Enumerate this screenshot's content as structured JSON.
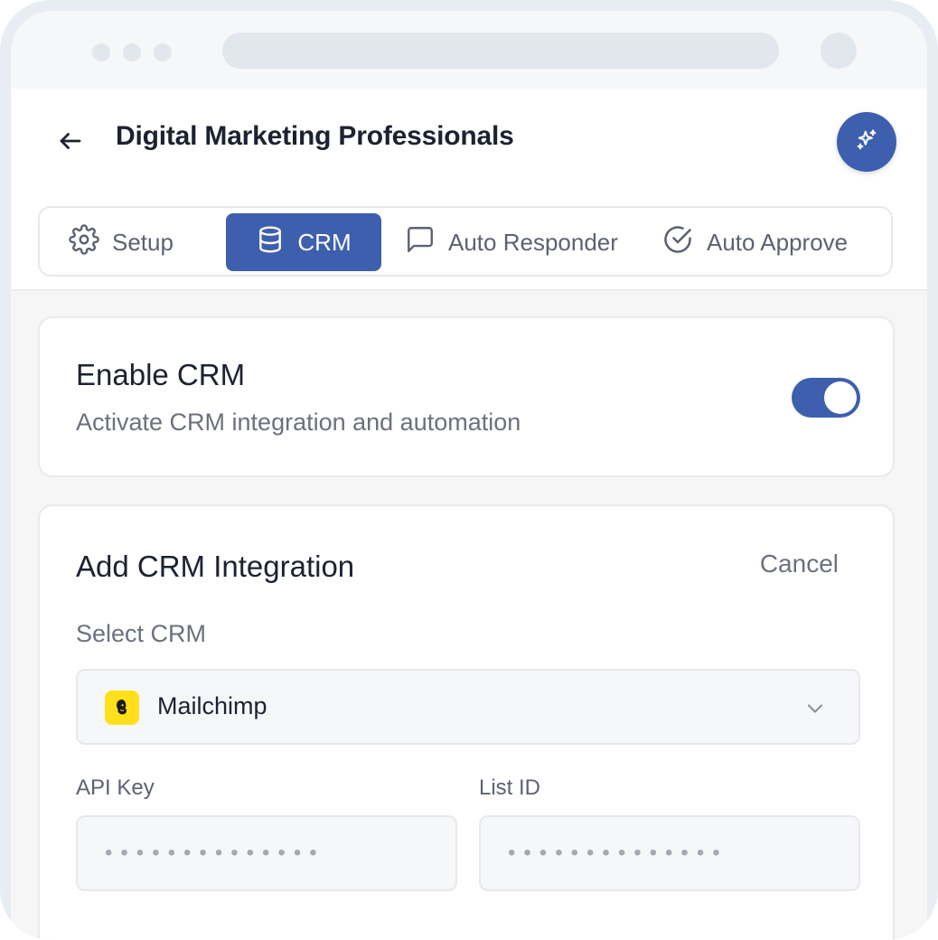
{
  "header": {
    "title": "Digital Marketing Professionals",
    "back_icon": "arrow-left-icon",
    "ai_icon": "sparkles-icon"
  },
  "tabs": [
    {
      "label": "Setup",
      "icon": "gear-icon",
      "active": false
    },
    {
      "label": "CRM",
      "icon": "database-icon",
      "active": true
    },
    {
      "label": "Auto Responder",
      "icon": "message-square-icon",
      "active": false
    },
    {
      "label": "Auto Approve",
      "icon": "check-circle-icon",
      "active": false
    }
  ],
  "enable_crm": {
    "title": "Enable CRM",
    "subtitle": "Activate CRM integration and automation",
    "enabled": true
  },
  "integration": {
    "title": "Add CRM Integration",
    "cancel_label": "Cancel",
    "select_label": "Select CRM",
    "selected_crm": "Mailchimp",
    "api_key_label": "API Key",
    "api_key_placeholder": "••••••••••••••",
    "list_id_label": "List ID",
    "list_id_placeholder": "••••••••••••••"
  },
  "colors": {
    "accent": "#3d5fad",
    "mailchimp_yellow": "#ffe01b"
  }
}
